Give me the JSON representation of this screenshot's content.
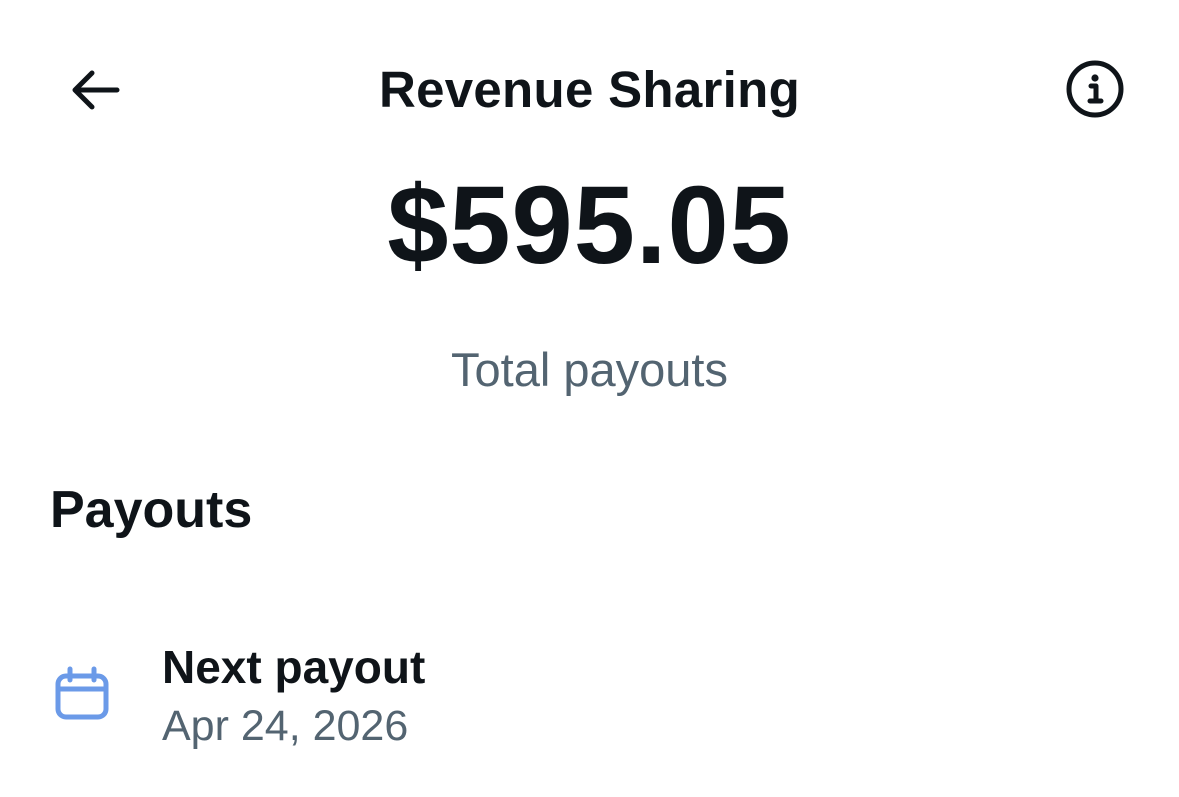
{
  "header": {
    "title": "Revenue Sharing",
    "back_icon": "arrow-left-icon",
    "info_icon": "info-circle-icon"
  },
  "summary": {
    "amount": "$595.05",
    "label": "Total payouts"
  },
  "payouts": {
    "heading": "Payouts",
    "next": {
      "icon": "calendar-icon",
      "title": "Next payout",
      "date": "Apr 24, 2026"
    }
  },
  "colors": {
    "text": "#0f1419",
    "secondary_text": "#536471",
    "icon_accent": "#6b9ae8",
    "background": "#ffffff"
  }
}
